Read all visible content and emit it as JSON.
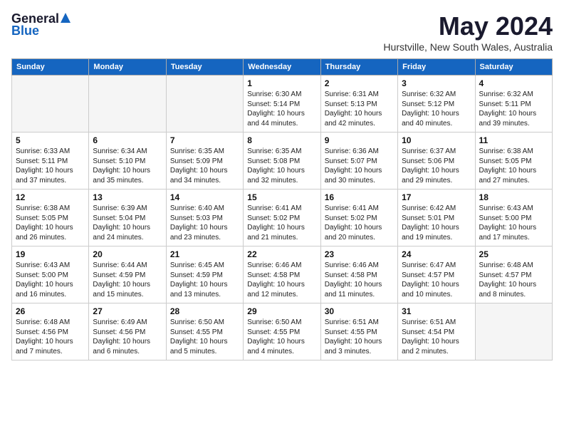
{
  "logo": {
    "general": "General",
    "blue": "Blue"
  },
  "title": "May 2024",
  "location": "Hurstville, New South Wales, Australia",
  "days_of_week": [
    "Sunday",
    "Monday",
    "Tuesday",
    "Wednesday",
    "Thursday",
    "Friday",
    "Saturday"
  ],
  "weeks": [
    [
      {
        "day": "",
        "info": ""
      },
      {
        "day": "",
        "info": ""
      },
      {
        "day": "",
        "info": ""
      },
      {
        "day": "1",
        "info": "Sunrise: 6:30 AM\nSunset: 5:14 PM\nDaylight: 10 hours\nand 44 minutes."
      },
      {
        "day": "2",
        "info": "Sunrise: 6:31 AM\nSunset: 5:13 PM\nDaylight: 10 hours\nand 42 minutes."
      },
      {
        "day": "3",
        "info": "Sunrise: 6:32 AM\nSunset: 5:12 PM\nDaylight: 10 hours\nand 40 minutes."
      },
      {
        "day": "4",
        "info": "Sunrise: 6:32 AM\nSunset: 5:11 PM\nDaylight: 10 hours\nand 39 minutes."
      }
    ],
    [
      {
        "day": "5",
        "info": "Sunrise: 6:33 AM\nSunset: 5:11 PM\nDaylight: 10 hours\nand 37 minutes."
      },
      {
        "day": "6",
        "info": "Sunrise: 6:34 AM\nSunset: 5:10 PM\nDaylight: 10 hours\nand 35 minutes."
      },
      {
        "day": "7",
        "info": "Sunrise: 6:35 AM\nSunset: 5:09 PM\nDaylight: 10 hours\nand 34 minutes."
      },
      {
        "day": "8",
        "info": "Sunrise: 6:35 AM\nSunset: 5:08 PM\nDaylight: 10 hours\nand 32 minutes."
      },
      {
        "day": "9",
        "info": "Sunrise: 6:36 AM\nSunset: 5:07 PM\nDaylight: 10 hours\nand 30 minutes."
      },
      {
        "day": "10",
        "info": "Sunrise: 6:37 AM\nSunset: 5:06 PM\nDaylight: 10 hours\nand 29 minutes."
      },
      {
        "day": "11",
        "info": "Sunrise: 6:38 AM\nSunset: 5:05 PM\nDaylight: 10 hours\nand 27 minutes."
      }
    ],
    [
      {
        "day": "12",
        "info": "Sunrise: 6:38 AM\nSunset: 5:05 PM\nDaylight: 10 hours\nand 26 minutes."
      },
      {
        "day": "13",
        "info": "Sunrise: 6:39 AM\nSunset: 5:04 PM\nDaylight: 10 hours\nand 24 minutes."
      },
      {
        "day": "14",
        "info": "Sunrise: 6:40 AM\nSunset: 5:03 PM\nDaylight: 10 hours\nand 23 minutes."
      },
      {
        "day": "15",
        "info": "Sunrise: 6:41 AM\nSunset: 5:02 PM\nDaylight: 10 hours\nand 21 minutes."
      },
      {
        "day": "16",
        "info": "Sunrise: 6:41 AM\nSunset: 5:02 PM\nDaylight: 10 hours\nand 20 minutes."
      },
      {
        "day": "17",
        "info": "Sunrise: 6:42 AM\nSunset: 5:01 PM\nDaylight: 10 hours\nand 19 minutes."
      },
      {
        "day": "18",
        "info": "Sunrise: 6:43 AM\nSunset: 5:00 PM\nDaylight: 10 hours\nand 17 minutes."
      }
    ],
    [
      {
        "day": "19",
        "info": "Sunrise: 6:43 AM\nSunset: 5:00 PM\nDaylight: 10 hours\nand 16 minutes."
      },
      {
        "day": "20",
        "info": "Sunrise: 6:44 AM\nSunset: 4:59 PM\nDaylight: 10 hours\nand 15 minutes."
      },
      {
        "day": "21",
        "info": "Sunrise: 6:45 AM\nSunset: 4:59 PM\nDaylight: 10 hours\nand 13 minutes."
      },
      {
        "day": "22",
        "info": "Sunrise: 6:46 AM\nSunset: 4:58 PM\nDaylight: 10 hours\nand 12 minutes."
      },
      {
        "day": "23",
        "info": "Sunrise: 6:46 AM\nSunset: 4:58 PM\nDaylight: 10 hours\nand 11 minutes."
      },
      {
        "day": "24",
        "info": "Sunrise: 6:47 AM\nSunset: 4:57 PM\nDaylight: 10 hours\nand 10 minutes."
      },
      {
        "day": "25",
        "info": "Sunrise: 6:48 AM\nSunset: 4:57 PM\nDaylight: 10 hours\nand 8 minutes."
      }
    ],
    [
      {
        "day": "26",
        "info": "Sunrise: 6:48 AM\nSunset: 4:56 PM\nDaylight: 10 hours\nand 7 minutes."
      },
      {
        "day": "27",
        "info": "Sunrise: 6:49 AM\nSunset: 4:56 PM\nDaylight: 10 hours\nand 6 minutes."
      },
      {
        "day": "28",
        "info": "Sunrise: 6:50 AM\nSunset: 4:55 PM\nDaylight: 10 hours\nand 5 minutes."
      },
      {
        "day": "29",
        "info": "Sunrise: 6:50 AM\nSunset: 4:55 PM\nDaylight: 10 hours\nand 4 minutes."
      },
      {
        "day": "30",
        "info": "Sunrise: 6:51 AM\nSunset: 4:55 PM\nDaylight: 10 hours\nand 3 minutes."
      },
      {
        "day": "31",
        "info": "Sunrise: 6:51 AM\nSunset: 4:54 PM\nDaylight: 10 hours\nand 2 minutes."
      },
      {
        "day": "",
        "info": ""
      }
    ]
  ]
}
